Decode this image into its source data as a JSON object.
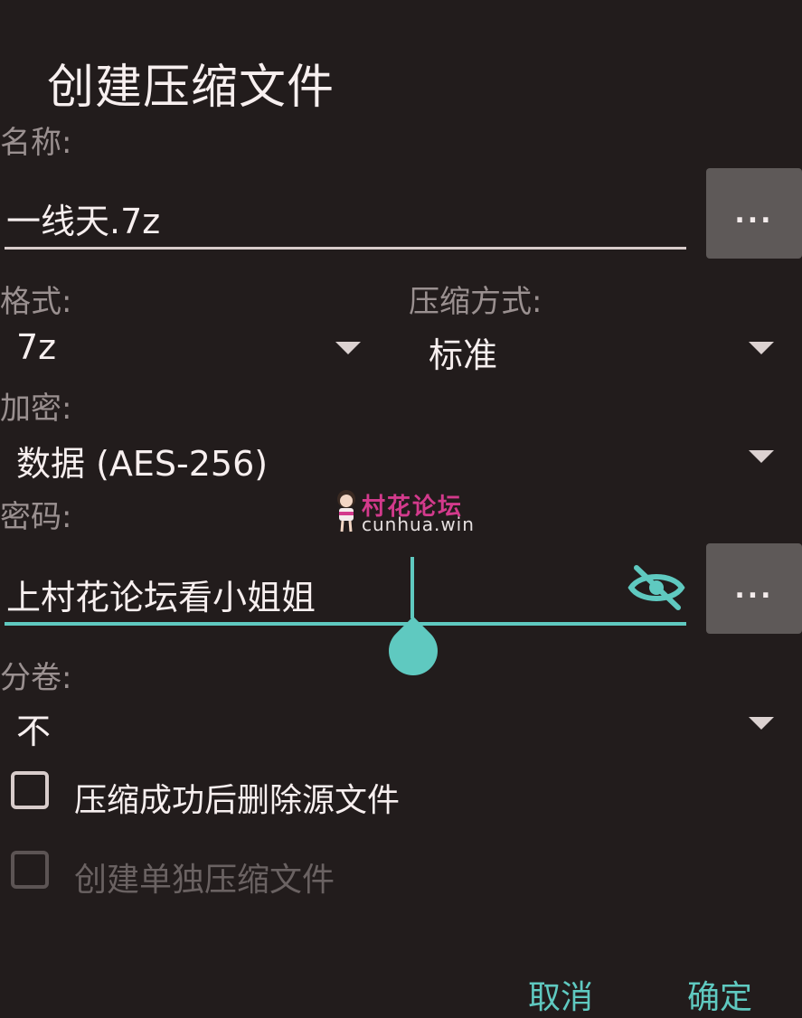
{
  "dialog": {
    "title": "创建压缩文件",
    "name_label": "名称:",
    "name_value": "一线天.7z",
    "browse_label": "...",
    "format_label": "格式:",
    "format_value": "7z",
    "method_label": "压缩方式:",
    "method_value": "标准",
    "encrypt_label": "加密:",
    "encrypt_value": "数据 (AES-256)",
    "password_label": "密码:",
    "password_value": "上村花论坛看小姐姐",
    "password_browse_label": "...",
    "split_label": "分卷:",
    "split_value": "不",
    "delete_source_label": "压缩成功后删除源文件",
    "delete_source_checked": false,
    "separate_archive_label": "创建单独压缩文件",
    "separate_archive_checked": false,
    "separate_archive_enabled": false,
    "cancel_label": "取消",
    "confirm_label": "确定"
  },
  "watermark": {
    "name": "村花论坛",
    "url": "cunhua.win"
  },
  "colors": {
    "background": "#221c1c",
    "accent": "#5fc9c0",
    "button_bg": "#5e5958",
    "watermark": "#d33a8c"
  },
  "icons": {
    "visibility_toggle": "eye-off-icon",
    "dropdown": "triangle-down-icon"
  }
}
